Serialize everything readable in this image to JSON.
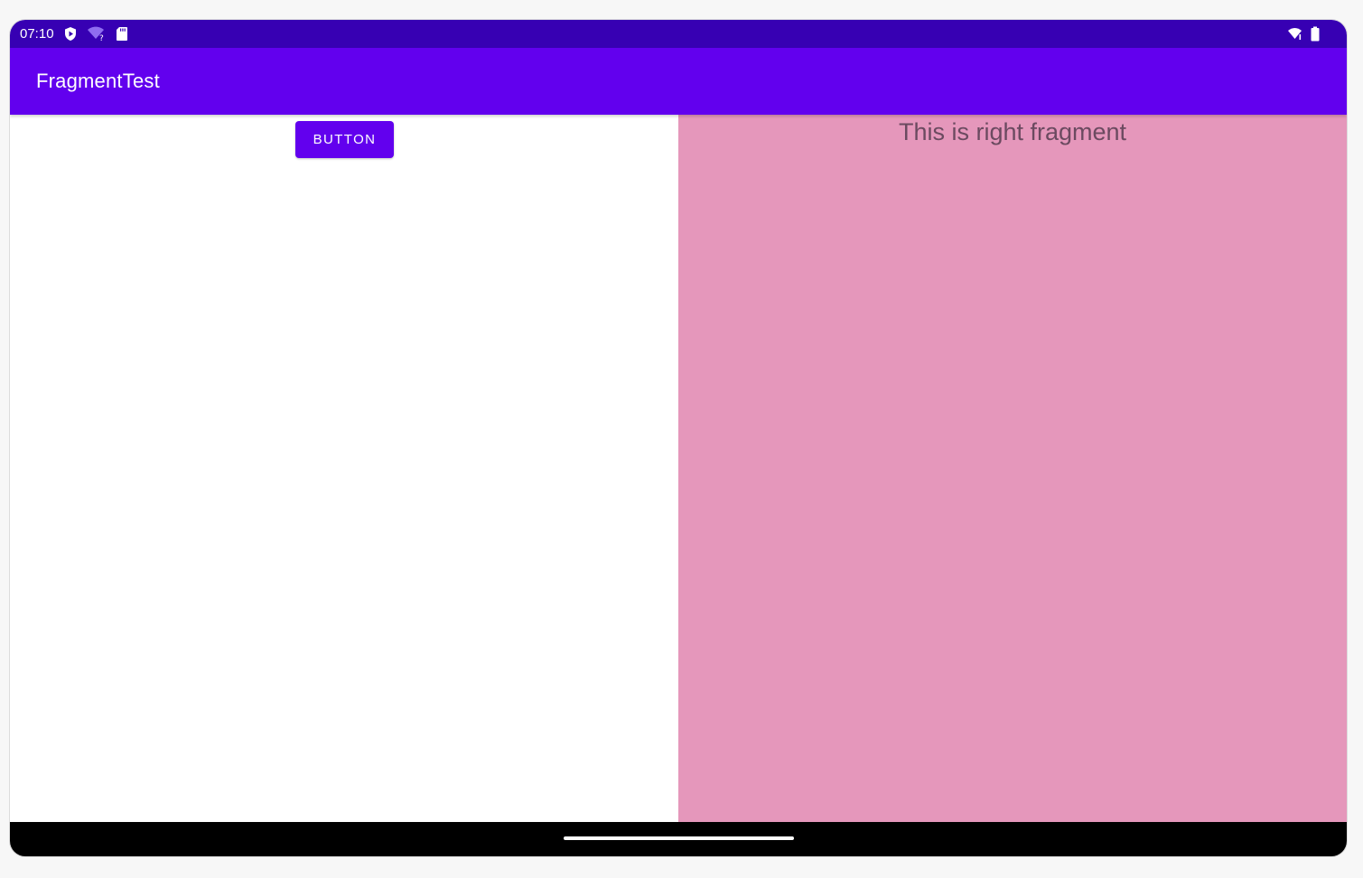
{
  "status_bar": {
    "time": "07:10",
    "icons_left": [
      "shield-play-icon",
      "wifi-question-icon",
      "sd-card-icon"
    ],
    "icons_right": [
      "wifi-signal-icon",
      "battery-icon"
    ]
  },
  "app_bar": {
    "title": "FragmentTest"
  },
  "left_fragment": {
    "button_label": "BUTTON"
  },
  "right_fragment": {
    "text": "This is right fragment",
    "background_color": "#e597bb"
  },
  "colors": {
    "status_bar": "#3700b3",
    "primary": "#6200ee",
    "nav_bar": "#000000"
  }
}
